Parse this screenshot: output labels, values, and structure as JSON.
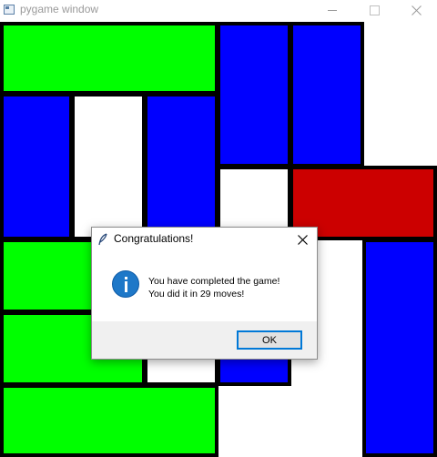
{
  "window": {
    "title": "pygame window"
  },
  "colors": {
    "green_piece": "#00ff00",
    "blue_piece": "#0000ff",
    "red_piece": "#cc0000",
    "empty_cell": "#ffffff",
    "border": "#000000",
    "ok_button_focus": "#0078d7"
  },
  "board": {
    "grid_size": "6x6",
    "rows": [
      [
        "green",
        "green",
        "green",
        "blue",
        "blue",
        "empty"
      ],
      [
        "blue",
        "empty",
        "blue",
        "blue",
        "blue",
        "empty"
      ],
      [
        "blue",
        "empty",
        "blue",
        "empty",
        "red",
        "red"
      ],
      [
        "green",
        "green",
        "empty",
        "empty",
        "empty",
        "blue"
      ],
      [
        "green",
        "green",
        "empty",
        "blue",
        "empty",
        "blue"
      ],
      [
        "green",
        "green",
        "green",
        "empty",
        "empty",
        "blue"
      ]
    ]
  },
  "dialog": {
    "title": "Congratulations!",
    "message_line1": "You have completed the game!",
    "message_line2": "You did it in 29 moves!",
    "ok_label": "OK",
    "icon": "info-icon"
  }
}
